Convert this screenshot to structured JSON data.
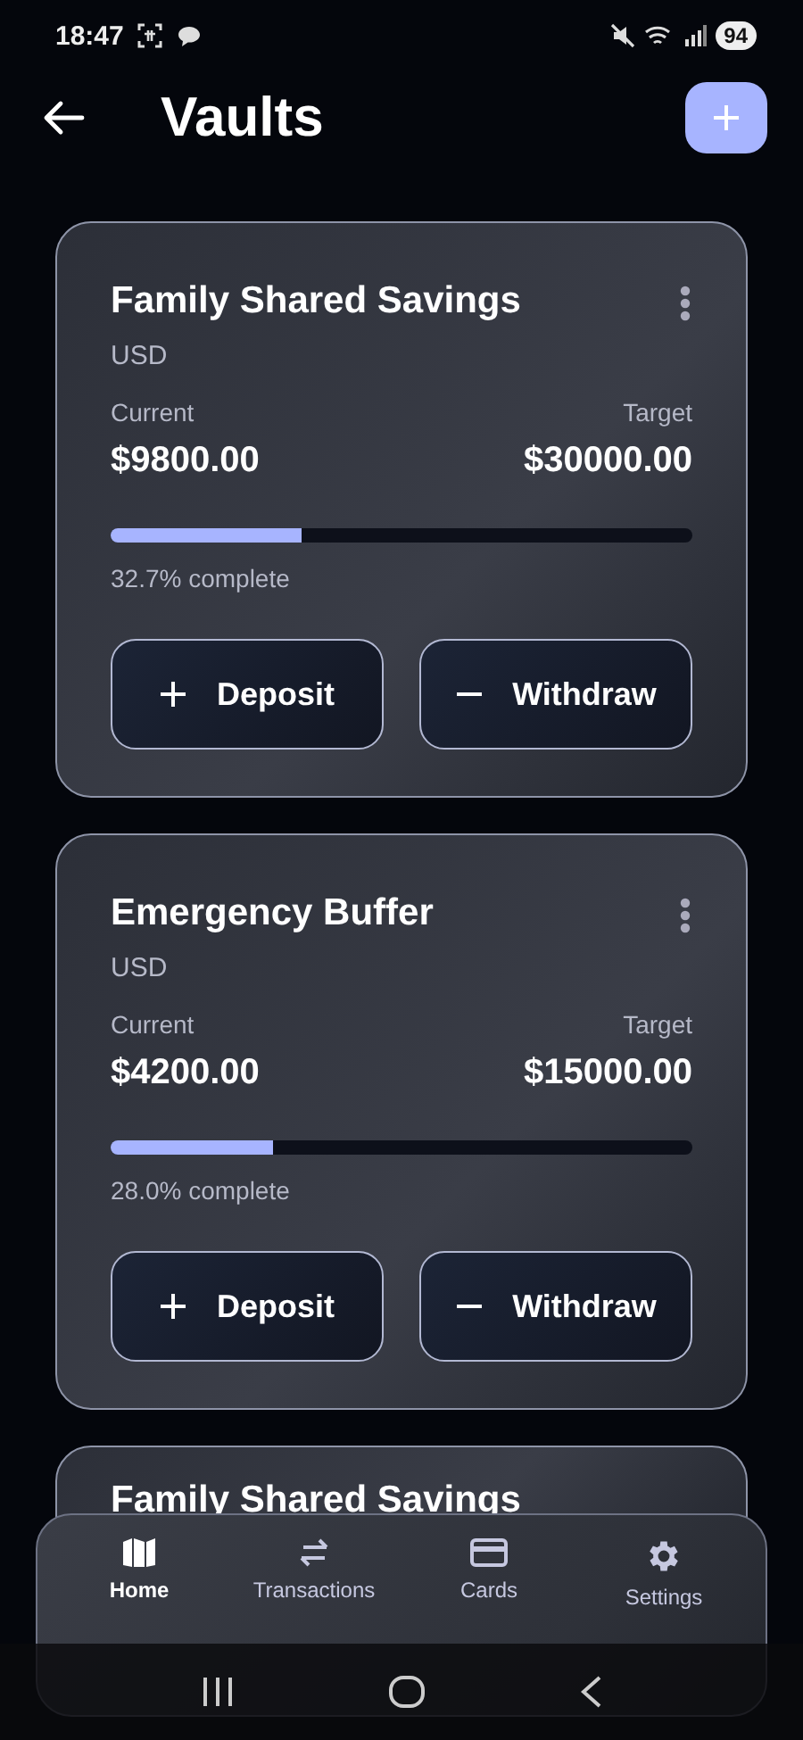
{
  "status_bar": {
    "time": "18:47",
    "battery": "94"
  },
  "header": {
    "title": "Vaults"
  },
  "vaults": [
    {
      "name": "Family Shared Savings",
      "currency": "USD",
      "current_label": "Current",
      "current": "$9800.00",
      "target_label": "Target",
      "target": "$30000.00",
      "level": 0.327,
      "progress_text": "32.7% complete",
      "actions": [
        {
          "kind": "deposit",
          "label": "Deposit"
        },
        {
          "kind": "withdraw",
          "label": "Withdraw"
        }
      ]
    },
    {
      "name": "Emergency Buffer",
      "currency": "USD",
      "current_label": "Current",
      "current": "$4200.00",
      "target_label": "Target",
      "target": "$15000.00",
      "level": 0.28,
      "progress_text": "28.0% complete",
      "actions": [
        {
          "kind": "deposit",
          "label": "Deposit"
        },
        {
          "kind": "withdraw",
          "label": "Withdraw"
        }
      ]
    },
    {
      "name": "Family Shared Savings"
    }
  ],
  "bottom_nav": [
    {
      "kind": "home",
      "label": "Home",
      "selected": true
    },
    {
      "kind": "transactions",
      "label": "Transactions",
      "selected": false
    },
    {
      "kind": "cards",
      "label": "Cards",
      "selected": false
    },
    {
      "kind": "settings",
      "label": "Settings",
      "selected": false
    }
  ]
}
